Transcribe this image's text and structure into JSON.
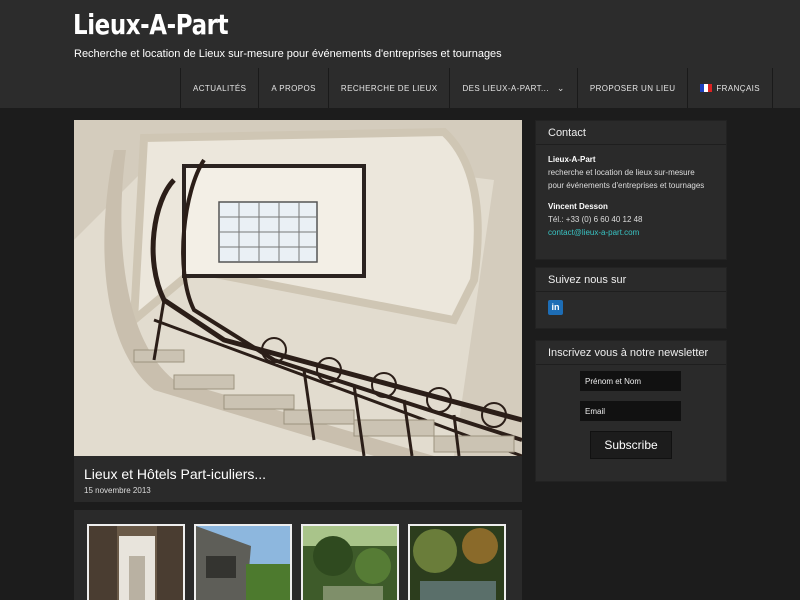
{
  "site": {
    "title": "Lieux-A-Part",
    "description": "Recherche et location de Lieux sur-mesure pour événements d'entreprises et tournages"
  },
  "nav": {
    "items": [
      "ACTUALITÉS",
      "A PROPOS",
      "RECHERCHE DE LIEUX",
      "DES LIEUX-A-PART...",
      "PROPOSER UN LIEU",
      "FRANÇAIS"
    ],
    "dropdown_icon": "chevron-down-icon",
    "language_icon": "french-flag-icon"
  },
  "post": {
    "title": "Lieux et Hôtels Part-iculiers...",
    "date": "15 novembre 2013"
  },
  "sidebar": {
    "contact": {
      "title": "Contact",
      "company": "Lieux-A-Part",
      "tagline_1": "recherche et location de lieux sur-mesure",
      "tagline_2": "pour événements d'entreprises et tournages",
      "person": "Vincent Desson",
      "phone": "Tél.: +33 (0) 6 60 40 12 48",
      "email": "contact@lieux-a-part.com"
    },
    "follow": {
      "title": "Suivez nous sur",
      "icon": "linkedin-icon",
      "icon_text": "in"
    },
    "newsletter": {
      "title": "Inscrivez vous à notre newsletter",
      "name_placeholder": "Prénom et Nom",
      "email_placeholder": "Email",
      "button": "Subscribe"
    }
  },
  "colors": {
    "background": "#1c1c1c",
    "panel": "#2a2a2a",
    "header": "#2c2c2c",
    "link": "#39c3c3"
  }
}
